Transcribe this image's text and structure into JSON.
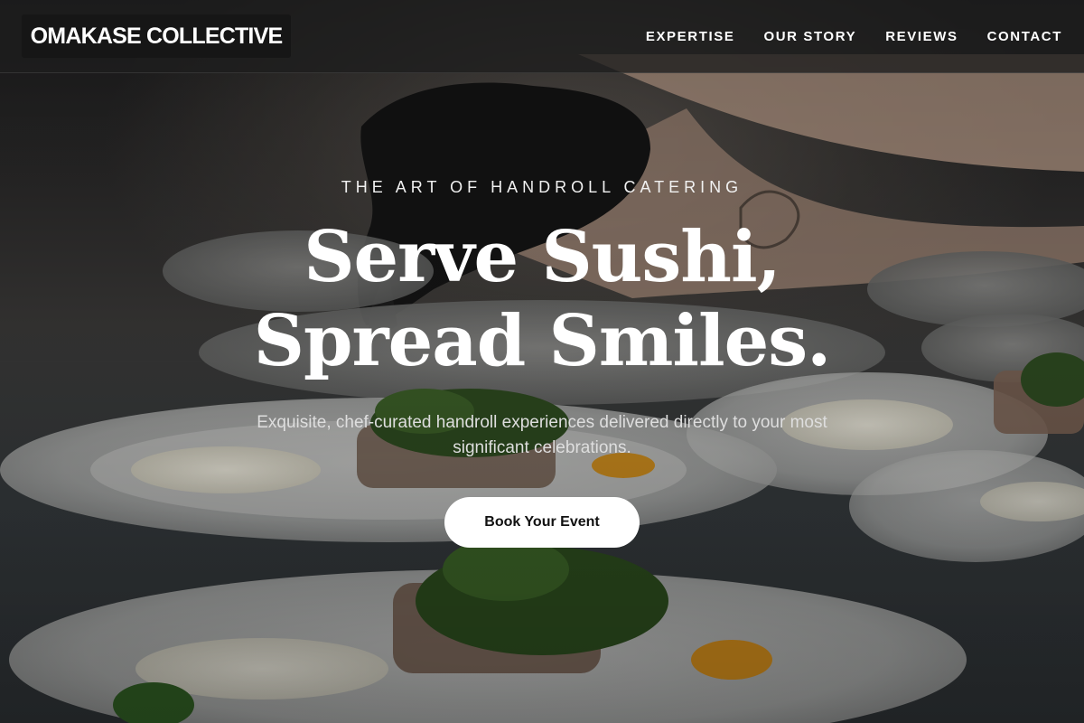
{
  "header": {
    "logo": "OMAKASE COLLECTIVE",
    "nav": [
      {
        "label": "EXPERTISE"
      },
      {
        "label": "OUR STORY"
      },
      {
        "label": "REVIEWS"
      },
      {
        "label": "CONTACT"
      }
    ]
  },
  "hero": {
    "eyebrow": "THE ART OF HANDROLL CATERING",
    "headline_line1": "Serve Sushi,",
    "headline_line2": "Spread Smiles.",
    "subtext": "Exquisite, chef-curated handroll experiences delivered directly to your most significant celebrations.",
    "cta_label": "Book Your Event"
  },
  "colors": {
    "header_bg": "#1e1e1e",
    "logo_bg": "#161616",
    "text": "#ffffff",
    "cta_bg": "#ffffff",
    "cta_text": "#111111"
  }
}
